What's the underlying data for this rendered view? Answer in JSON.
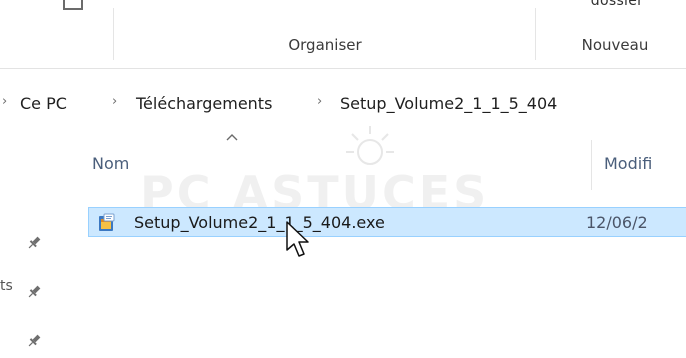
{
  "ribbon": {
    "cut_label": "dossier",
    "groups": {
      "organize": "Organiser",
      "new": "Nouveau"
    }
  },
  "address": {
    "crumbs": [
      "Ce PC",
      "Téléchargements",
      "Setup_Volume2_1_1_5_404"
    ]
  },
  "columns": {
    "name": "Nom",
    "modified": "Modifi"
  },
  "file": {
    "name": "Setup_Volume2_1_1_5_404.exe",
    "date": "12/06/2"
  },
  "sidebar": {
    "cut_text": "ts"
  },
  "watermark": "PC ASTUCES",
  "colors": {
    "selection": "#cce8ff",
    "selection_border": "#99d1ff"
  },
  "icons": [
    "pin-icon",
    "installer-exe-icon",
    "sort-ascending-icon",
    "mouse-cursor-icon"
  ]
}
